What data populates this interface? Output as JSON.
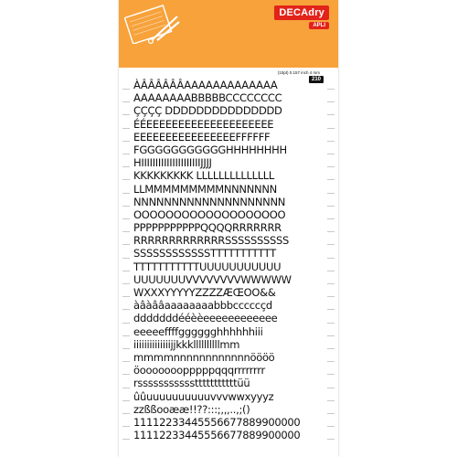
{
  "header": {
    "brand": "DECAdry",
    "sub_brand": "APLI",
    "accent_color": "#f7a23b",
    "brand_color": "#e2231a",
    "illustration_icon": "scissors-and-sheet-illustration-icon"
  },
  "spec": {
    "text": "(10pt)  0.157 inch  4 mm",
    "ref": "210"
  },
  "letter_rows": [
    "ÀÂÂÂÂÂÂAAAAAAAAAAAAA",
    "AAAAAAAABBBBBCCCCCCCC",
    "ÇÇÇÇ DDDDDDDDDDDDDDD",
    "ÉÉEEEEEEEEEEEEEEEEEEEE",
    "EEEEEEEEEEEEEEEEFFFFFF",
    "FGGGGGGGGGGGHHHHHHHH",
    "HIIIIIIIIIIIIIIIIIIIIIJJJJ",
    "KKKKKKKKK LLLLLLLLLLLLLL",
    "LLMMMMMMMMMNNNNNNN",
    "NNNNNNNNNNNNNNNNNNNN",
    "OOOOOOOOOOOOOOOOOOO",
    "PPPPPPPPPPPQQQQRRRRRRR",
    "RRRRRRRRRRRRRSSSSSSSSSS",
    "SSSSSSSSSSSSTTTTTTTTTTT",
    "TTTTTTTTTTTUUUUUUUUUUU",
    "UUUUUUUVVVVVVVVWWWWW",
    "WXXXYYYYYZZZZÆŒOO&&",
    "àâàââaaaaaaaabbbcccccçd",
    "dddddddééèèeeeeeeeeeeee",
    "eeeeeffffgggggghhhhhhiii",
    "iiiiiiiiiiiiiijjkkkllllllllllmm",
    "mmmmnnnnnnnnnnnnöööö",
    "öooooooopppppqqqrrrrrrrr",
    "rssssssssssstttttttttttüü",
    "ûûuuuuuuuuuuvvvwwxyyyz",
    "zzßßooææ!!??:::;,,,..,;()",
    "11112233445556677889900000",
    "11112233445556677889900000"
  ]
}
